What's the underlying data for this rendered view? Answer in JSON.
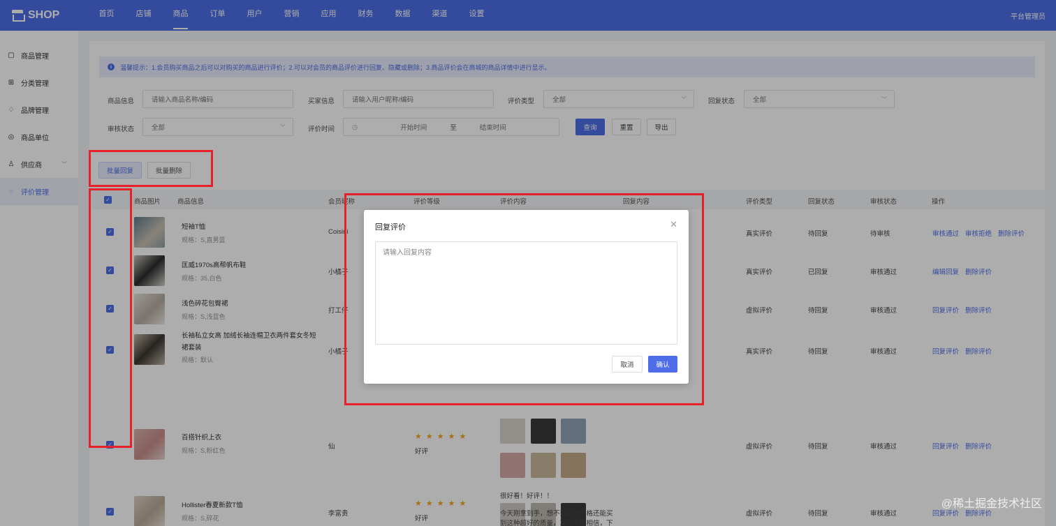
{
  "header": {
    "logo": "SHOP",
    "nav": [
      "首页",
      "店铺",
      "商品",
      "订单",
      "用户",
      "营销",
      "应用",
      "财务",
      "数据",
      "渠道",
      "设置"
    ],
    "active_nav": "商品",
    "user": "平台管理员"
  },
  "sidebar": {
    "items": [
      {
        "label": "商品管理",
        "icon": "bag-icon"
      },
      {
        "label": "分类管理",
        "icon": "grid-icon"
      },
      {
        "label": "品牌管理",
        "icon": "badge-icon"
      },
      {
        "label": "商品单位",
        "icon": "unit-icon"
      },
      {
        "label": "供应商",
        "icon": "user-icon"
      },
      {
        "label": "评价管理",
        "icon": "comment-icon"
      }
    ]
  },
  "tip": "温馨提示：1.会员购买商品之后可以对购买的商品进行评价；2.可以对会员的商品评价进行回复、隐藏或删除；3.商品评价会在商城的商品详情中进行显示。",
  "filters": {
    "product_label": "商品信息",
    "product_placeholder": "请输入商品名称/编码",
    "buyer_label": "买家信息",
    "buyer_placeholder": "请输入用户昵称/编码",
    "type_label": "评价类型",
    "type_value": "全部",
    "reply_label": "回复状态",
    "reply_value": "全部",
    "audit_label": "审核状态",
    "audit_value": "全部",
    "time_label": "评价时间",
    "start_placeholder": "开始时间",
    "to": "至",
    "end_placeholder": "结束时间",
    "query": "查询",
    "reset": "重置",
    "export": "导出"
  },
  "bulk": {
    "reply": "批量回复",
    "delete": "批量删除"
  },
  "table": {
    "headers": [
      "商品图片",
      "商品信息",
      "会员昵称",
      "评价等级",
      "评价内容",
      "回复内容",
      "评价类型",
      "回复状态",
      "审核状态",
      "操作"
    ],
    "rows": [
      {
        "name": "短袖T恤",
        "spec": "规格：S,直男蓝",
        "member": "Coisini",
        "type": "真实评价",
        "reply": "待回复",
        "audit": "待审核",
        "actions": [
          "审核通过",
          "审核拒绝",
          "删除评价"
        ]
      },
      {
        "name": "匡威1970s高帮帆布鞋",
        "spec": "规格：35,白色",
        "member": "小橘子",
        "type": "真实评价",
        "reply": "已回复",
        "audit": "审核通过",
        "actions": [
          "编辑回复",
          "删除评价"
        ]
      },
      {
        "name": "浅色碎花包臀裙",
        "spec": "规格：S,浅蓝色",
        "member": "打工仔",
        "type": "虚拟评价",
        "reply": "待回复",
        "audit": "审核通过",
        "actions": [
          "回复评价",
          "删除评价"
        ]
      },
      {
        "name": "长袖私立女高 加绒长袖连帽卫衣两件套女冬短裙套装",
        "spec": "规格：默认",
        "member": "小橘子",
        "type": "真实评价",
        "reply": "待回复",
        "audit": "审核通过",
        "actions": [
          "回复评价",
          "删除评价"
        ]
      },
      {
        "name": "百搭针织上衣",
        "spec": "规格：S,粉红色",
        "member": "仙",
        "rating": "好评",
        "type": "虚拟评价",
        "reply": "待回复",
        "audit": "审核通过",
        "actions": [
          "回复评价",
          "删除评价"
        ]
      },
      {
        "name": "Hollister春夏新款T恤",
        "spec": "规格：S,碎花",
        "member": "李富贵",
        "rating": "好评",
        "comment": "很好看！好评！！",
        "type": "虚拟评价",
        "reply": "待回复",
        "audit": "审核通过",
        "actions": [
          "回复评价",
          "删除评价"
        ]
      }
    ],
    "last_comment_line1": "今天刚拿到手，想不到这个价格还能买",
    "last_comment_line2": "到这种超好的质量，真的不敢相信，下"
  },
  "dialog": {
    "title": "回复评价",
    "placeholder": "请输入回复内容",
    "cancel": "取消",
    "confirm": "确认"
  },
  "watermark": "@稀土掘金技术社区",
  "colors": {
    "primary": "#4d6ee8",
    "highlight": "#e8202a",
    "star": "#f5a623"
  }
}
